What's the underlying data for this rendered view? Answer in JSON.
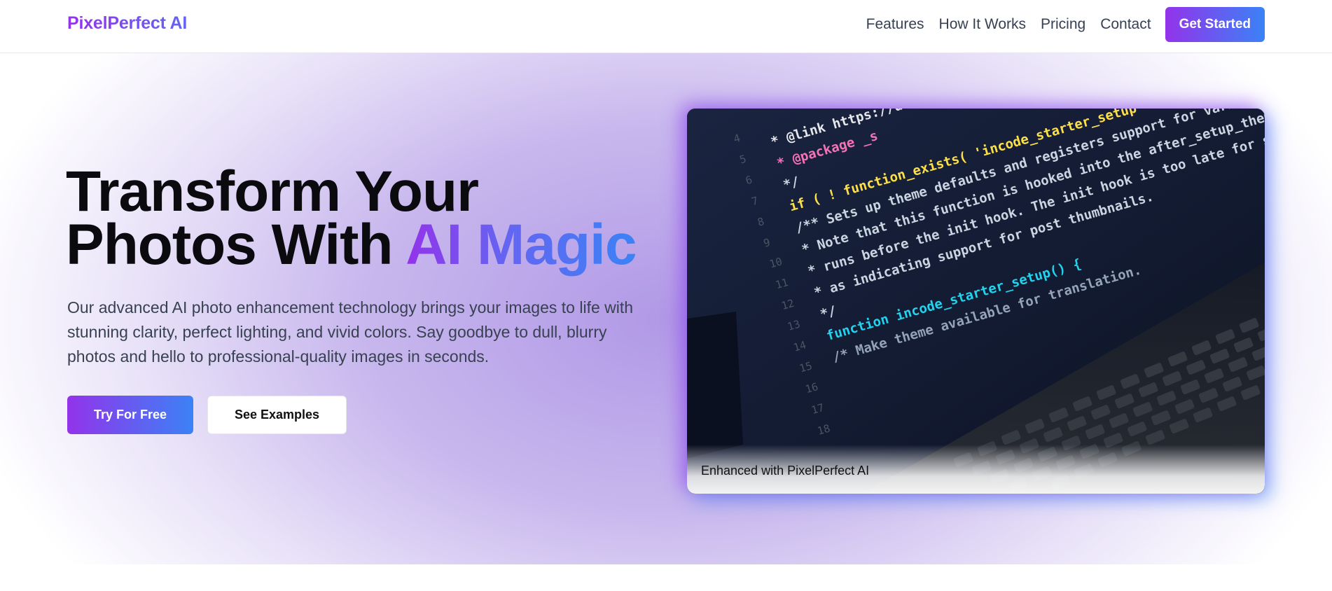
{
  "brand": {
    "logo_text": "PixelPerfect AI"
  },
  "nav": {
    "links": [
      "Features",
      "How It Works",
      "Pricing",
      "Contact"
    ],
    "cta_label": "Get Started"
  },
  "hero": {
    "title_line1": "Transform Your",
    "title_line2_plain": "Photos With ",
    "title_line2_highlight": "AI Magic",
    "description": "Our advanced AI photo enhancement technology brings your images to life with stunning clarity, perfect lighting, and vivid colors. Say goodbye to dull, blurry photos and hello to professional-quality images in seconds.",
    "primary_button": "Try For Free",
    "secondary_button": "See Examples",
    "image_caption": "Enhanced with PixelPerfect AI"
  },
  "code_screen": {
    "line_numbers": [
      "4",
      "5",
      "6",
      "7",
      "8",
      "9",
      "10",
      "11",
      "12",
      "13",
      "14",
      "15",
      "16",
      "17",
      "18"
    ],
    "lines": [
      " * @link https://devel",
      " * @package _s",
      " */",
      "if ( ! function_exists( 'incode_starter_setup' ) ) :",
      "/** Sets up theme defaults and registers support for various WordPress features.",
      " * Note that this function is hooked into the after_setup_theme hook, which",
      " * runs before the init hook. The init hook is too late for some features, such",
      " * as indicating support for post thumbnails.",
      " */",
      "function incode_starter_setup() {",
      "  /* Make theme available for translation."
    ]
  },
  "colors": {
    "accent_purple": "#9333ea",
    "accent_blue": "#3b82f6"
  }
}
